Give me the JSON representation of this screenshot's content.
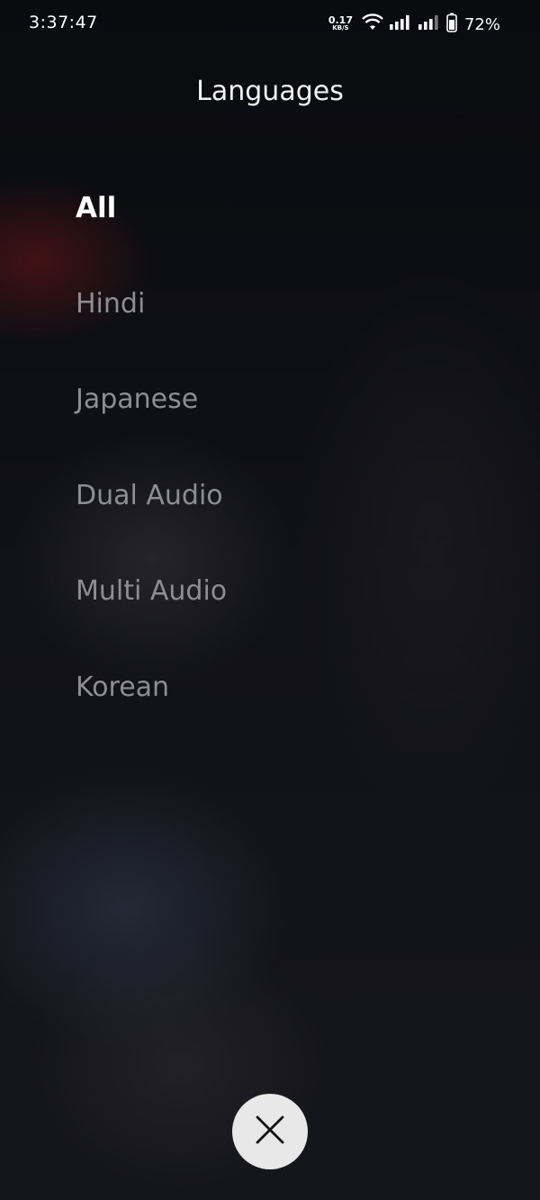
{
  "status_bar": {
    "time": "3:37:47",
    "net_speed_value": "0.17",
    "net_speed_unit": "KB/S",
    "battery": "72%"
  },
  "header": {
    "title": "Languages"
  },
  "languages": [
    {
      "label": "All",
      "selected": true
    },
    {
      "label": "Hindi",
      "selected": false
    },
    {
      "label": "Japanese",
      "selected": false
    },
    {
      "label": "Dual Audio",
      "selected": false
    },
    {
      "label": "Multi Audio",
      "selected": false
    },
    {
      "label": "Korean",
      "selected": false
    }
  ],
  "icons": {
    "close": "close-icon",
    "wifi": "wifi-icon",
    "signal": "signal-icon",
    "battery": "battery-icon"
  }
}
